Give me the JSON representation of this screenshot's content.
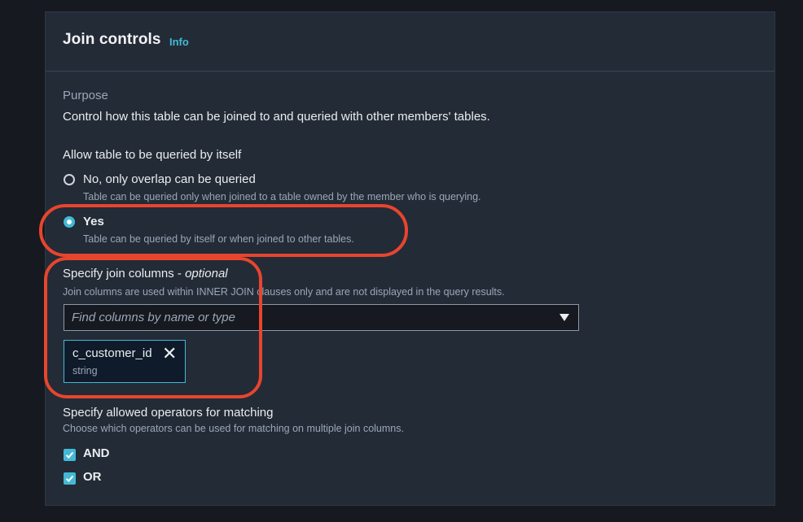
{
  "panel": {
    "title": "Join controls",
    "info": "Info"
  },
  "purpose": {
    "label": "Purpose",
    "text": "Control how this table can be joined to and queried with other members' tables."
  },
  "query_itself": {
    "label": "Allow table to be queried by itself",
    "options": [
      {
        "label": "No, only overlap can be queried",
        "description": "Table can be queried only when joined to a table owned by the member who is querying.",
        "selected": false
      },
      {
        "label": "Yes",
        "description": "Table can be queried by itself or when joined to other tables.",
        "selected": true
      }
    ]
  },
  "join_columns": {
    "label": "Specify join columns -",
    "label_optional": "optional",
    "description": "Join columns are used within INNER JOIN clauses only and are not displayed in the query results.",
    "placeholder": "Find columns by name or type",
    "tokens": [
      {
        "name": "c_customer_id",
        "type": "string"
      }
    ]
  },
  "operators": {
    "label": "Specify allowed operators for matching",
    "description": "Choose which operators can be used for matching on multiple join columns.",
    "options": [
      {
        "label": "AND",
        "checked": true
      },
      {
        "label": "OR",
        "checked": true
      }
    ]
  },
  "colors": {
    "accent": "#44b9d6",
    "highlight": "#e8452e",
    "panel_bg": "#232b37"
  }
}
